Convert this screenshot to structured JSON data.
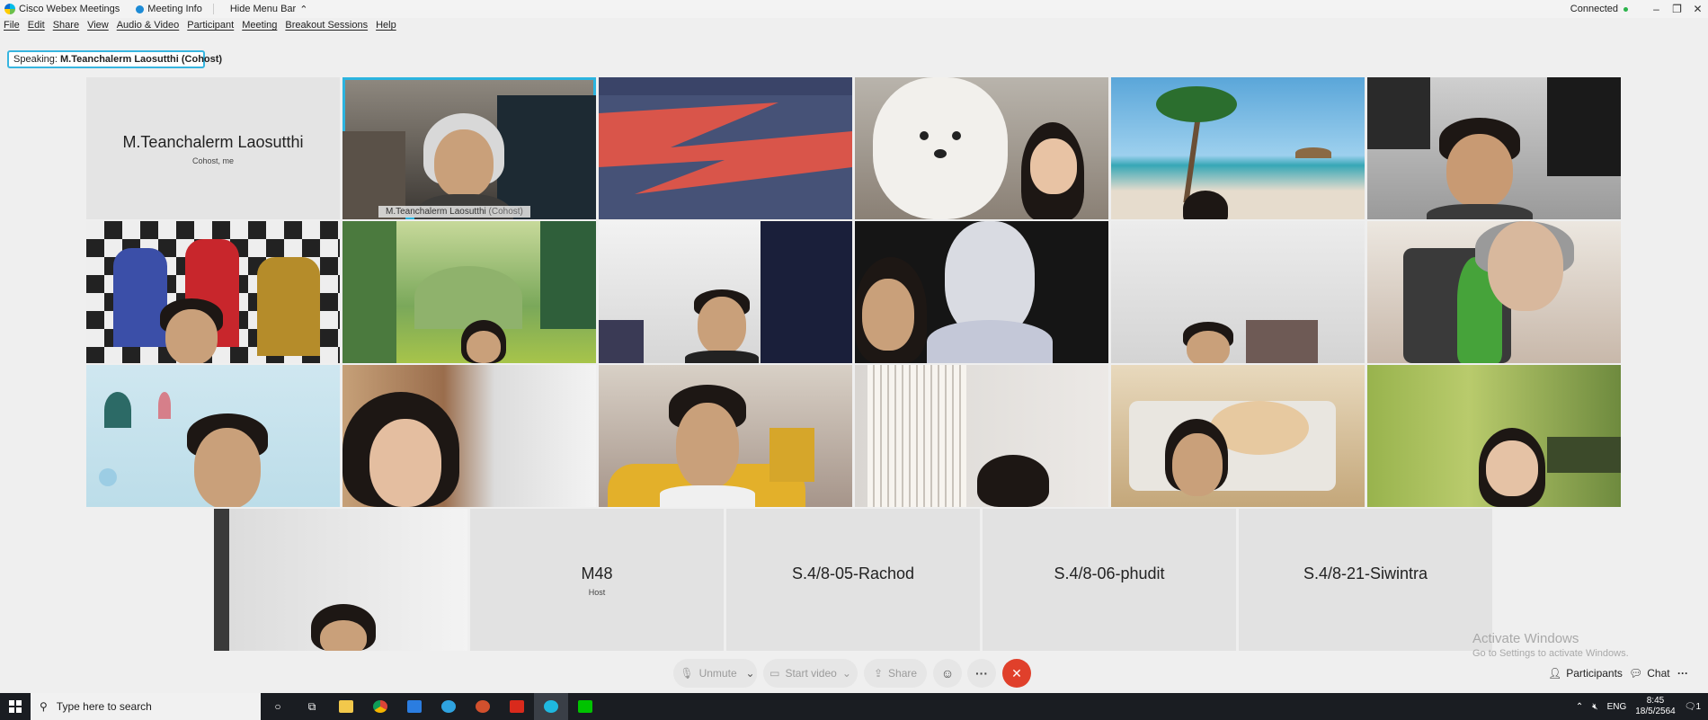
{
  "titlebar": {
    "app_name": "Cisco Webex Meetings",
    "meeting_info": "Meeting Info",
    "hide_menu_bar": "Hide Menu Bar",
    "connection_status": "Connected",
    "minimize": "–",
    "restore": "❐",
    "close": "✕"
  },
  "menu": [
    "File",
    "Edit",
    "Share",
    "View",
    "Audio & Video",
    "Participant",
    "Meeting",
    "Breakout Sessions",
    "Help"
  ],
  "speaking": {
    "label": "Speaking:",
    "name": "M.Teanchalerm Laosutthi (Cohost)"
  },
  "tiles": {
    "self_card": {
      "name": "M.Teanchalerm Laosutthi",
      "role": "Cohost, me"
    },
    "active_video": {
      "name": "M.Teanchalerm Laosutthi",
      "role": "(Cohost)"
    },
    "m48": {
      "name": "M48",
      "role": "Host"
    },
    "rachod": {
      "name": "S.4/8-05-Rachod"
    },
    "phudit": {
      "name": "S.4/8-06-phudit"
    },
    "siwintra": {
      "name": "S.4/8-21-Siwintra"
    }
  },
  "toolbar": {
    "unmute": "Unmute",
    "start_video": "Start video",
    "share": "Share",
    "reactions_icon": "smiley-icon",
    "more": "···",
    "end": "✕",
    "participants": "Participants",
    "chat": "Chat",
    "overflow": "···"
  },
  "watermark": {
    "line1": "Activate Windows",
    "line2": "Go to Settings to activate Windows."
  },
  "taskbar": {
    "search_placeholder": "Type here to search",
    "language": "ENG",
    "time": "8:45",
    "date": "18/5/2564",
    "notification_count": "1"
  },
  "colors": {
    "accent": "#2cb4df",
    "end_call": "#e0402b",
    "taskbar": "#1a1d22"
  }
}
